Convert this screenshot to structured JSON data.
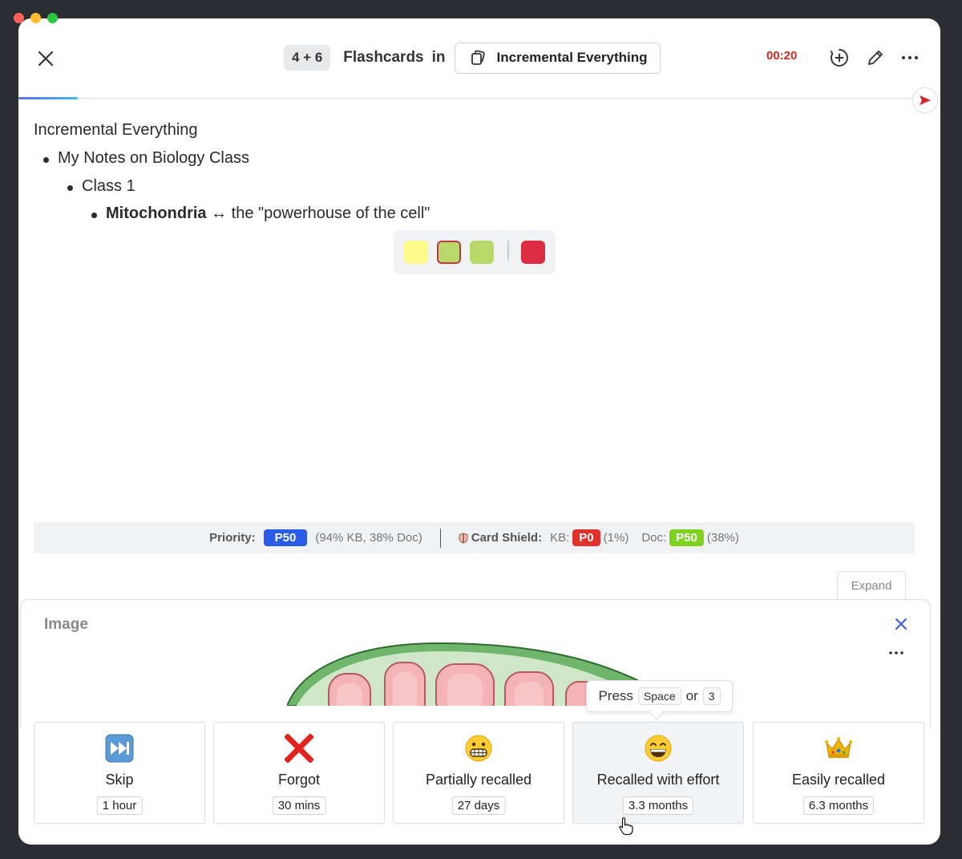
{
  "header": {
    "count": "4 + 6",
    "flashcards_label": "Flashcards",
    "in_label": "in",
    "document_name": "Incremental Everything",
    "timer": "00:20"
  },
  "content": {
    "root": "Incremental Everything",
    "level1": "My Notes on Biology Class",
    "level2": "Class 1",
    "card_front": "Mitochondria",
    "card_arrow": "↔",
    "card_back": "the \"powerhouse of the cell\""
  },
  "palette": {
    "colors": [
      "#fdf98a",
      "#b8d96a",
      "#b8d96a",
      "#dc2d42"
    ]
  },
  "priority": {
    "label": "Priority:",
    "value": "P50",
    "detail": "(94% KB, 38% Doc)",
    "shield_label": "Card Shield:",
    "kb_label": "KB:",
    "kb_value": "P0",
    "kb_detail": "(1%)",
    "doc_label": "Doc:",
    "doc_value": "P50",
    "doc_detail": "(38%)",
    "colors": {
      "priority": "#2b5ce6",
      "kb": "#e0322b",
      "doc": "#7ed321"
    }
  },
  "panel": {
    "expand_label": "Expand",
    "title": "Image"
  },
  "tooltip": {
    "press": "Press",
    "key1": "Space",
    "or": "or",
    "key2": "3"
  },
  "grades": [
    {
      "icon": "fast-forward-icon",
      "label": "Skip",
      "interval": "1 hour"
    },
    {
      "icon": "cross-mark-icon",
      "label": "Forgot",
      "interval": "30 mins"
    },
    {
      "icon": "grimacing-face-icon",
      "label": "Partially recalled",
      "interval": "27 days"
    },
    {
      "icon": "grinning-face-icon",
      "label": "Recalled with effort",
      "interval": "3.3 months"
    },
    {
      "icon": "crown-icon",
      "label": "Easily recalled",
      "interval": "6.3 months"
    }
  ]
}
